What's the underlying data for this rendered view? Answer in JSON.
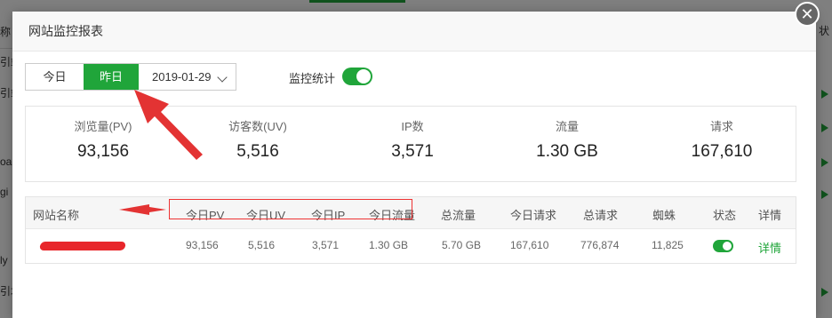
{
  "background": {
    "left_cells": [
      "称",
      "引站",
      "引站",
      "oa",
      "gi",
      "ly",
      "引塔"
    ],
    "right_header": "状"
  },
  "modal": {
    "title": "网站监控报表",
    "close_glyph": "✕"
  },
  "toolbar": {
    "today_label": "今日",
    "yesterday_label": "昨日",
    "date_value": "2019-01-29",
    "monitor_label": "监控统计",
    "monitor_enabled": true
  },
  "stats": [
    {
      "label": "浏览量(PV)",
      "value": "93,156"
    },
    {
      "label": "访客数(UV)",
      "value": "5,516"
    },
    {
      "label": "IP数",
      "value": "3,571"
    },
    {
      "label": "流量",
      "value": "1.30 GB"
    },
    {
      "label": "请求",
      "value": "167,610"
    }
  ],
  "table": {
    "headers": {
      "site_name": "网站名称",
      "today_pv": "今日PV",
      "today_uv": "今日UV",
      "today_ip": "今日IP",
      "today_traffic": "今日流量",
      "total_traffic": "总流量",
      "today_requests": "今日请求",
      "total_requests": "总请求",
      "spider": "蜘蛛",
      "status": "状态",
      "details": "详情"
    },
    "rows": [
      {
        "today_pv": "93,156",
        "today_uv": "5,516",
        "today_ip": "3,571",
        "today_traffic": "1.30 GB",
        "total_traffic": "5.70 GB",
        "today_requests": "167,610",
        "total_requests": "776,874",
        "spider": "11,825",
        "status_enabled": true,
        "details_link": "详情"
      }
    ]
  },
  "colors": {
    "accent": "#20a53a",
    "annotation": "#e33333"
  },
  "icons": {
    "close": "close-icon",
    "chevron": "chevron-down-icon",
    "row_arrow": "play-arrow-icon"
  }
}
